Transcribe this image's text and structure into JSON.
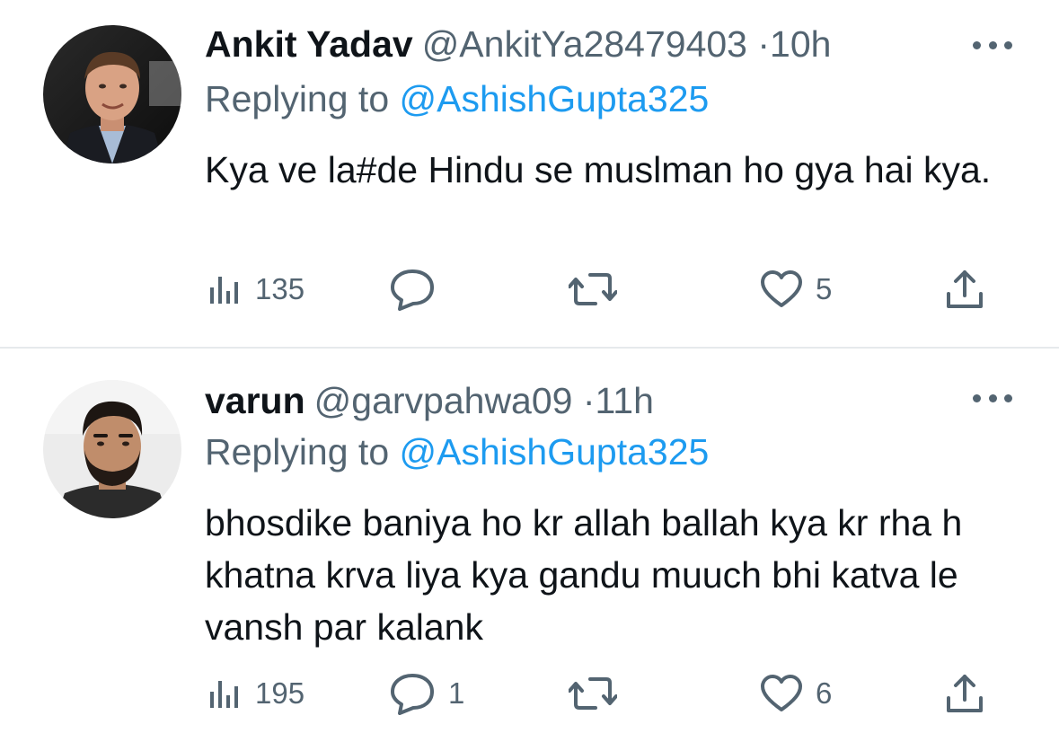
{
  "tweets": [
    {
      "display_name": "Ankit Yadav",
      "handle": "@AnkitYa28479403",
      "separator": "·",
      "time": "10h",
      "replying_prefix": "Replying to",
      "replying_mention": "@AshishGupta325",
      "text": "Kya ve la#de Hindu se muslman ho gya hai kya.",
      "views": "135",
      "replies": "",
      "retweets": "",
      "likes": "5",
      "avatar_icon": "person-photo-suit"
    },
    {
      "display_name": "varun",
      "handle": "@garvpahwa09",
      "separator": "·",
      "time": "11h",
      "replying_prefix": "Replying to",
      "replying_mention": "@AshishGupta325",
      "text": "bhosdike baniya ho kr allah ballah kya kr rha h khatna krva liya kya gandu muuch bhi katva le vansh par kalank",
      "views": "195",
      "replies": "1",
      "retweets": "",
      "likes": "6",
      "avatar_icon": "person-photo-beard"
    }
  ],
  "colors": {
    "text_primary": "#0f1419",
    "text_secondary": "#536471",
    "link": "#1d9bf0",
    "divider": "#e6e9ec"
  },
  "icons": {
    "views": "bar-chart-icon",
    "reply": "speech-bubble-icon",
    "retweet": "retweet-arrows-icon",
    "like": "heart-icon",
    "share": "share-upload-icon",
    "more": "more-dots-icon"
  }
}
